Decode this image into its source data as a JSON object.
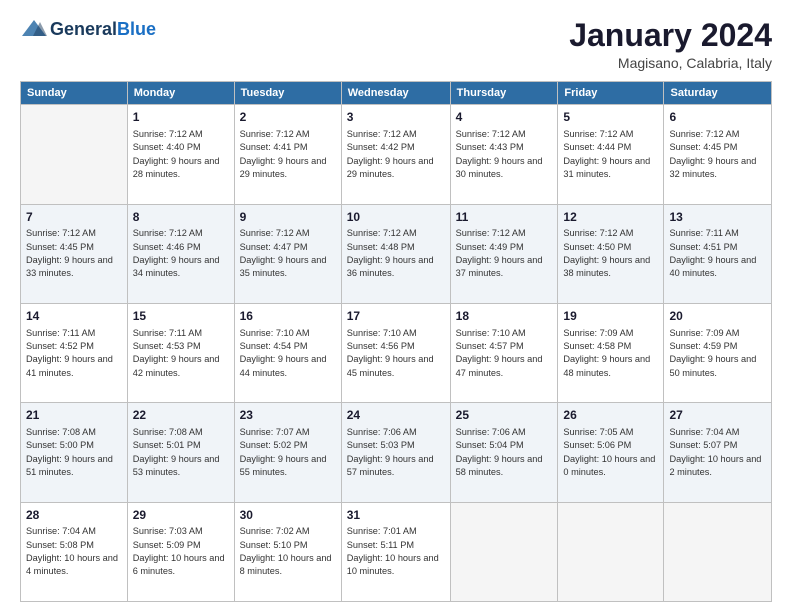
{
  "header": {
    "logo_general": "General",
    "logo_blue": "Blue",
    "month_title": "January 2024",
    "subtitle": "Magisano, Calabria, Italy"
  },
  "days_of_week": [
    "Sunday",
    "Monday",
    "Tuesday",
    "Wednesday",
    "Thursday",
    "Friday",
    "Saturday"
  ],
  "weeks": [
    [
      {
        "num": "",
        "empty": true
      },
      {
        "num": "1",
        "rise": "7:12 AM",
        "set": "4:40 PM",
        "daylight": "9 hours and 28 minutes."
      },
      {
        "num": "2",
        "rise": "7:12 AM",
        "set": "4:41 PM",
        "daylight": "9 hours and 29 minutes."
      },
      {
        "num": "3",
        "rise": "7:12 AM",
        "set": "4:42 PM",
        "daylight": "9 hours and 29 minutes."
      },
      {
        "num": "4",
        "rise": "7:12 AM",
        "set": "4:43 PM",
        "daylight": "9 hours and 30 minutes."
      },
      {
        "num": "5",
        "rise": "7:12 AM",
        "set": "4:44 PM",
        "daylight": "9 hours and 31 minutes."
      },
      {
        "num": "6",
        "rise": "7:12 AM",
        "set": "4:45 PM",
        "daylight": "9 hours and 32 minutes."
      }
    ],
    [
      {
        "num": "7",
        "rise": "7:12 AM",
        "set": "4:45 PM",
        "daylight": "9 hours and 33 minutes."
      },
      {
        "num": "8",
        "rise": "7:12 AM",
        "set": "4:46 PM",
        "daylight": "9 hours and 34 minutes."
      },
      {
        "num": "9",
        "rise": "7:12 AM",
        "set": "4:47 PM",
        "daylight": "9 hours and 35 minutes."
      },
      {
        "num": "10",
        "rise": "7:12 AM",
        "set": "4:48 PM",
        "daylight": "9 hours and 36 minutes."
      },
      {
        "num": "11",
        "rise": "7:12 AM",
        "set": "4:49 PM",
        "daylight": "9 hours and 37 minutes."
      },
      {
        "num": "12",
        "rise": "7:12 AM",
        "set": "4:50 PM",
        "daylight": "9 hours and 38 minutes."
      },
      {
        "num": "13",
        "rise": "7:11 AM",
        "set": "4:51 PM",
        "daylight": "9 hours and 40 minutes."
      }
    ],
    [
      {
        "num": "14",
        "rise": "7:11 AM",
        "set": "4:52 PM",
        "daylight": "9 hours and 41 minutes."
      },
      {
        "num": "15",
        "rise": "7:11 AM",
        "set": "4:53 PM",
        "daylight": "9 hours and 42 minutes."
      },
      {
        "num": "16",
        "rise": "7:10 AM",
        "set": "4:54 PM",
        "daylight": "9 hours and 44 minutes."
      },
      {
        "num": "17",
        "rise": "7:10 AM",
        "set": "4:56 PM",
        "daylight": "9 hours and 45 minutes."
      },
      {
        "num": "18",
        "rise": "7:10 AM",
        "set": "4:57 PM",
        "daylight": "9 hours and 47 minutes."
      },
      {
        "num": "19",
        "rise": "7:09 AM",
        "set": "4:58 PM",
        "daylight": "9 hours and 48 minutes."
      },
      {
        "num": "20",
        "rise": "7:09 AM",
        "set": "4:59 PM",
        "daylight": "9 hours and 50 minutes."
      }
    ],
    [
      {
        "num": "21",
        "rise": "7:08 AM",
        "set": "5:00 PM",
        "daylight": "9 hours and 51 minutes."
      },
      {
        "num": "22",
        "rise": "7:08 AM",
        "set": "5:01 PM",
        "daylight": "9 hours and 53 minutes."
      },
      {
        "num": "23",
        "rise": "7:07 AM",
        "set": "5:02 PM",
        "daylight": "9 hours and 55 minutes."
      },
      {
        "num": "24",
        "rise": "7:06 AM",
        "set": "5:03 PM",
        "daylight": "9 hours and 57 minutes."
      },
      {
        "num": "25",
        "rise": "7:06 AM",
        "set": "5:04 PM",
        "daylight": "9 hours and 58 minutes."
      },
      {
        "num": "26",
        "rise": "7:05 AM",
        "set": "5:06 PM",
        "daylight": "10 hours and 0 minutes."
      },
      {
        "num": "27",
        "rise": "7:04 AM",
        "set": "5:07 PM",
        "daylight": "10 hours and 2 minutes."
      }
    ],
    [
      {
        "num": "28",
        "rise": "7:04 AM",
        "set": "5:08 PM",
        "daylight": "10 hours and 4 minutes."
      },
      {
        "num": "29",
        "rise": "7:03 AM",
        "set": "5:09 PM",
        "daylight": "10 hours and 6 minutes."
      },
      {
        "num": "30",
        "rise": "7:02 AM",
        "set": "5:10 PM",
        "daylight": "10 hours and 8 minutes."
      },
      {
        "num": "31",
        "rise": "7:01 AM",
        "set": "5:11 PM",
        "daylight": "10 hours and 10 minutes."
      },
      {
        "num": "",
        "empty": true
      },
      {
        "num": "",
        "empty": true
      },
      {
        "num": "",
        "empty": true
      }
    ]
  ],
  "labels": {
    "sunrise": "Sunrise:",
    "sunset": "Sunset:",
    "daylight": "Daylight:"
  }
}
